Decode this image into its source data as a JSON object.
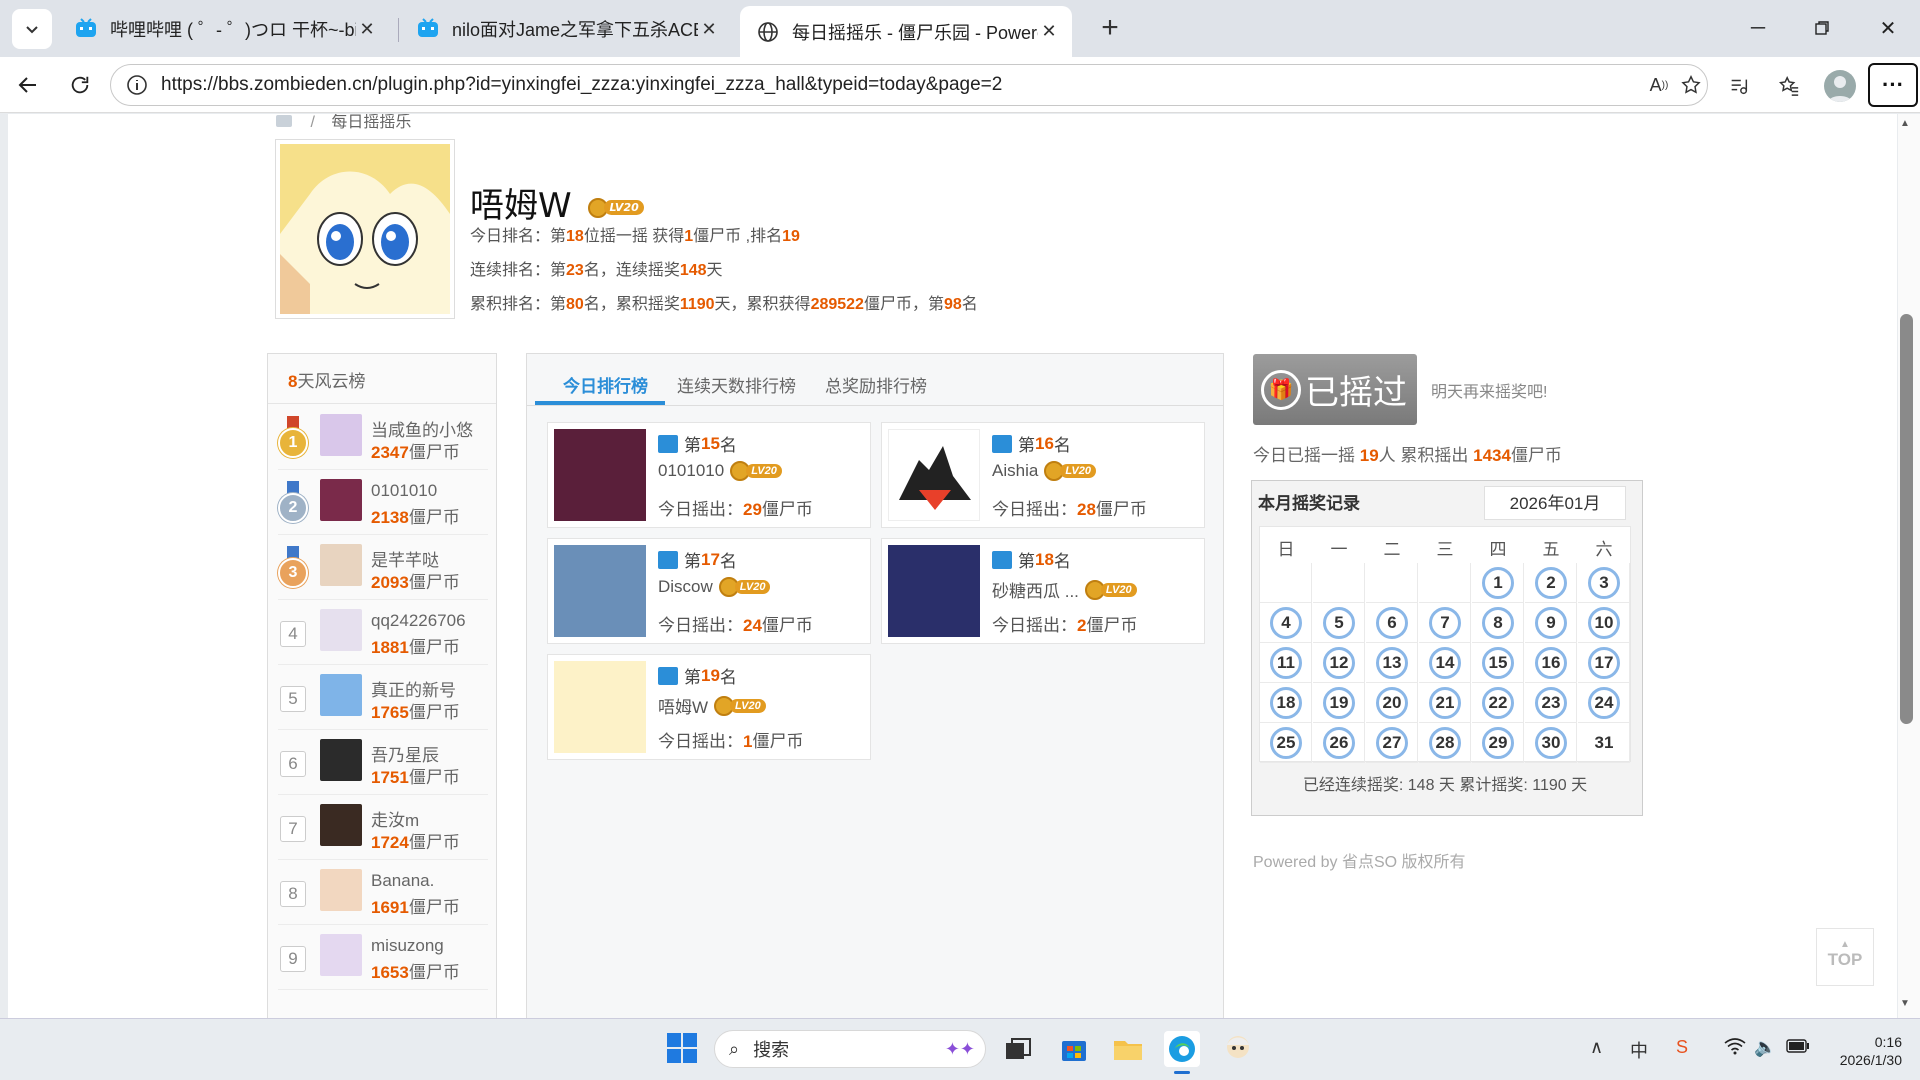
{
  "browser": {
    "tabs": [
      {
        "title": "哔哩哔哩 ( ゜- ゜)つロ 干杯~-bilibili",
        "active": false
      },
      {
        "title": "nilo面对Jame之军拿下五杀ACE! 最",
        "active": false
      },
      {
        "title": "每日摇摇乐 - 僵尸乐园 - Powered by",
        "active": true
      }
    ],
    "url": "https://bbs.zombieden.cn/plugin.php?id=yinxingfei_zzza:yinxingfei_zzza_hall&typeid=today&page=2",
    "icons": {
      "tab_menu": "chevron-down-icon",
      "new_tab": "plus-icon",
      "back": "back-arrow-icon",
      "reload": "reload-icon",
      "site_info": "info-icon",
      "read_aloud": "read-aloud-icon",
      "favorite": "star-icon",
      "media": "media-control-icon",
      "favorites_bar": "favorites-icon",
      "more": "more-icon"
    }
  },
  "page": {
    "breadcrumb": "每日摇摇乐",
    "user": {
      "name": "唔姆W",
      "level": "LV20",
      "line1": {
        "a": "今日排名：第",
        "b": "18",
        "c": "位摇一摇 获得",
        "d": "1",
        "e": "僵尸币 ,排名",
        "f": "19"
      },
      "line2": {
        "a": "连续排名：第",
        "b": "23",
        "c": "名，连续摇奖",
        "d": "148",
        "e": "天"
      },
      "line3": {
        "a": "累积排名：第",
        "b": "80",
        "c": "名，累积摇奖",
        "d": "1190",
        "e": "天，累积获得",
        "f": "289522",
        "g": "僵尸币，第",
        "h": "98",
        "i": "名"
      }
    },
    "left_rank": {
      "title_num": "8",
      "title_text": "天风云榜",
      "unit": "僵尸币",
      "rows": [
        {
          "rank": "1",
          "name": "当咸鱼的小悠",
          "coins": "2347"
        },
        {
          "rank": "2",
          "name": "0101010",
          "coins": "2138"
        },
        {
          "rank": "3",
          "name": "是芊芊哒",
          "coins": "2093"
        },
        {
          "rank": "4",
          "name": "qq24226706",
          "coins": "1881"
        },
        {
          "rank": "5",
          "name": "真正的新号",
          "coins": "1765"
        },
        {
          "rank": "6",
          "name": "吾乃星辰",
          "coins": "1751"
        },
        {
          "rank": "7",
          "name": "走汝m",
          "coins": "1724"
        },
        {
          "rank": "8",
          "name": "Banana.",
          "coins": "1691"
        },
        {
          "rank": "9",
          "name": "misuzong",
          "coins": "1653"
        }
      ]
    },
    "board": {
      "tabs": [
        "今日排行榜",
        "连续天数排行榜",
        "总奖励排行榜"
      ],
      "rank_prefix": "第",
      "rank_suffix": "名",
      "count_prefix": "今日摇出：",
      "count_suffix": "僵尸币",
      "level": "LV20",
      "cards": [
        {
          "rank": "15",
          "name": "0101010",
          "coins": "29"
        },
        {
          "rank": "16",
          "name": "Aishia",
          "coins": "28"
        },
        {
          "rank": "17",
          "name": "Discow",
          "coins": "24"
        },
        {
          "rank": "18",
          "name": "砂糖西瓜 ...",
          "coins": "2"
        },
        {
          "rank": "19",
          "name": "唔姆W",
          "coins": "1"
        }
      ]
    },
    "shake": {
      "button_label": "已摇过",
      "tip": "明天再来摇奖吧!",
      "summary": {
        "a": "今日已摇一摇 ",
        "b": "19",
        "c": "人 累积摇出 ",
        "d": "1434",
        "e": "僵尸币"
      }
    },
    "calendar": {
      "title": "本月摇奖记录",
      "month": "2026年01月",
      "weekdays": [
        "日",
        "一",
        "二",
        "三",
        "四",
        "五",
        "六"
      ],
      "first_weekday": 4,
      "days_in_month": 31,
      "marked_until": 30,
      "footer": "已经连续摇奖:   148 天  累计摇奖:   1190 天"
    },
    "powered": "Powered by 省点SO 版权所有",
    "top_label": "TOP"
  },
  "taskbar": {
    "search_placeholder": "搜索",
    "ime": "中",
    "time": "0:16",
    "date": "2026/1/30"
  }
}
